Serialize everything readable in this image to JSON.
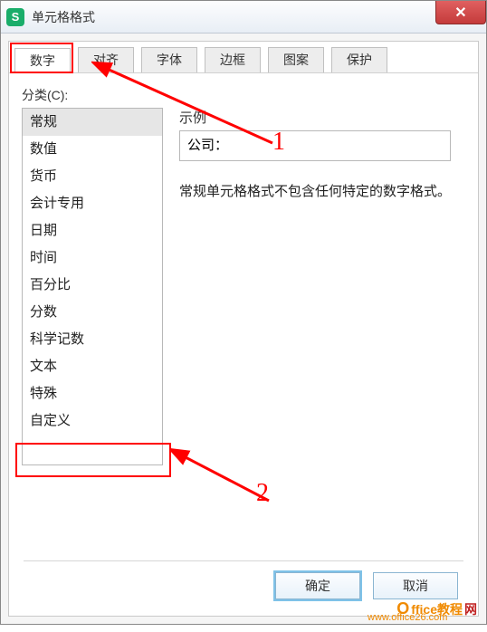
{
  "titlebar": {
    "icon_text": "S",
    "title": "单元格格式"
  },
  "tabs": [
    {
      "label": "数字",
      "active": true
    },
    {
      "label": "对齐",
      "active": false
    },
    {
      "label": "字体",
      "active": false
    },
    {
      "label": "边框",
      "active": false
    },
    {
      "label": "图案",
      "active": false
    },
    {
      "label": "保护",
      "active": false
    }
  ],
  "category_label": "分类(C):",
  "categories": [
    "常规",
    "数值",
    "货币",
    "会计专用",
    "日期",
    "时间",
    "百分比",
    "分数",
    "科学记数",
    "文本",
    "特殊",
    "自定义"
  ],
  "selected_category_index": 0,
  "sample": {
    "label": "示例",
    "value": "公司："
  },
  "description": "常规单元格格式不包含任何特定的数字格式。",
  "buttons": {
    "ok": "确定",
    "cancel": "取消"
  },
  "annotations": {
    "n1": "1",
    "n2": "2"
  },
  "watermark": {
    "brand_o": "O",
    "brand_ff": "ffice教程",
    "brand_net": "网",
    "url": "www.office26.com"
  }
}
